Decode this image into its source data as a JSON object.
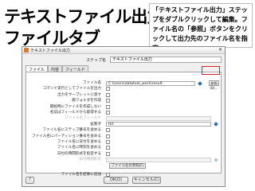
{
  "heading": {
    "line1": "テキストファイル出力",
    "line2": "ファイルタブ"
  },
  "callout": {
    "text": "「テキストファイル出力」ステップをダブルクリックして編集。ファイル名の「参照」ボタンをクリックして出力先のファイル名を指定。"
  },
  "dialog": {
    "title": "テキストファイル出力",
    "close": "✕",
    "step_label": "ステップ名",
    "step_value": "テキストファイル出力",
    "tabs": [
      {
        "label": "ファイル"
      },
      {
        "label": "内容"
      },
      {
        "label": "フィールド"
      }
    ],
    "rows": {
      "filename": {
        "label": "ファイル名",
        "value": "C:\\Users\\datafuel_work\\result",
        "button": "参照(B)..."
      },
      "r1": {
        "label": "コマンド実行としてファイルを出力"
      },
      "r2": {
        "label": "出力をサーブレットに渡す"
      },
      "r3": {
        "label": "親フォルダを作成"
      },
      "r4": {
        "label": "開始時にファイルを作成しない"
      },
      "r5": {
        "label": "名前はフィールドから取得する"
      },
      "r6": {
        "label": "ファイル名フィールド",
        "value": ""
      },
      "ext": {
        "label": "拡張子",
        "value": "txt"
      },
      "r8": {
        "label": "ファイル名にステップ番号を含める"
      },
      "r9": {
        "label": "ファイル名にパーティション番号を含める"
      },
      "r10": {
        "label": "ファイル名に日付を含める"
      },
      "r11": {
        "label": "ファイル名に時刻を含める"
      },
      "r12": {
        "label": "日付の時間形式を指定する"
      },
      "r13": {
        "label": "日付時刻形式",
        "value": ""
      },
      "showfiles": {
        "button": "ファイル名の参照(F)"
      },
      "r15": {
        "label": "ファイル名を結果に追加"
      }
    },
    "ok": "OK(O)",
    "cancel": "キャンセル(C)",
    "help": "?"
  }
}
